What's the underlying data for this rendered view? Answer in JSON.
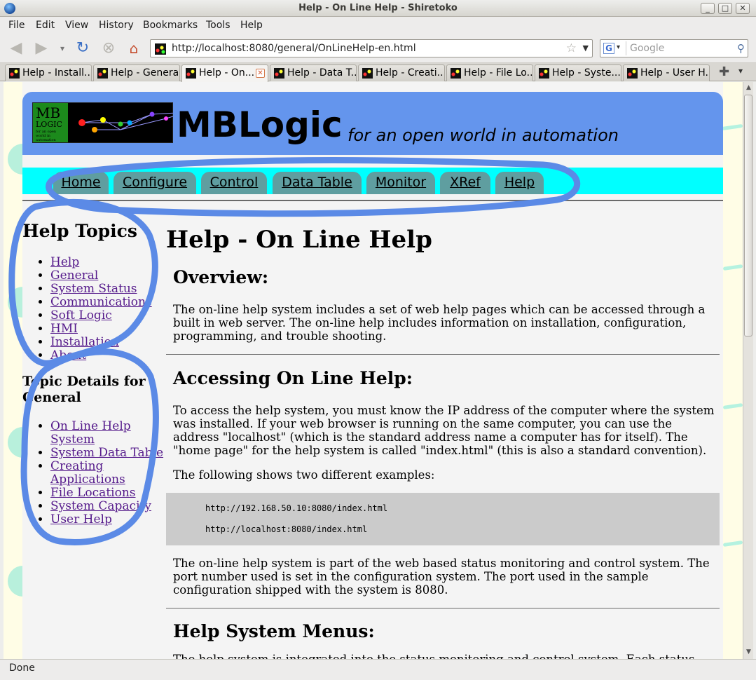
{
  "window": {
    "title": "Help - On Line Help - Shiretoko"
  },
  "menubar": {
    "items": [
      "File",
      "Edit",
      "View",
      "History",
      "Bookmarks",
      "Tools",
      "Help"
    ]
  },
  "toolbar": {
    "url": "http://localhost:8080/general/OnLineHelp-en.html",
    "search_engine": "G",
    "search_placeholder": "Google"
  },
  "tabs": [
    {
      "label": "Help - Install..."
    },
    {
      "label": "Help - General"
    },
    {
      "label": "Help - On...",
      "active": true
    },
    {
      "label": "Help - Data T..."
    },
    {
      "label": "Help - Creati..."
    },
    {
      "label": "Help - File Lo..."
    },
    {
      "label": "Help - Syste..."
    },
    {
      "label": "Help - User H..."
    }
  ],
  "page": {
    "logo": {
      "line1": "MB",
      "line2": "LOGIC",
      "small": "for an open world in automation"
    },
    "brand": "MBLogic",
    "tagline": "for an open world in automation",
    "nav": [
      "Home",
      "Configure",
      "Control",
      "Data Table",
      "Monitor",
      "XRef",
      "Help"
    ],
    "sidebar": {
      "topics_title": "Help Topics",
      "topics": [
        "Help",
        "General",
        "System Status",
        "Communications",
        "Soft Logic",
        "HMI",
        "Installation",
        "About"
      ],
      "details_title": "Topic Details for General",
      "details": [
        "On Line Help System",
        "System Data Table",
        "Creating Applications",
        "File Locations",
        "System Capacity",
        "User Help"
      ]
    },
    "main": {
      "title": "Help - On Line Help",
      "overview_heading": "Overview:",
      "overview_text": "The on-line help system includes a set of web help pages which can be accessed through a built in web server. The on-line help includes information on installation, configuration, programming, and trouble shooting.",
      "access_heading": "Accessing On Line Help:",
      "access_text": "To access the help system, you must know the IP address of the computer where the system was installed. If your web browser is running on the same computer, you can use the address \"localhost\" (which is the standard address name a computer has for itself). The \"home page\" for the help system is called \"index.html\" (this is also a standard convention).",
      "examples_text": "The following shows two different examples:",
      "code": [
        "http://192.168.50.10:8080/index.html",
        "http://localhost:8080/index.html"
      ],
      "port_text": "The on-line help system is part of the web based status monitoring and control system. The port number used is set in the configuration system. The port used in the sample configuration shipped with the system is 8080.",
      "menus_heading": "Help System Menus:",
      "menus_text": "The help system is integrated into the status monitoring and control system. Each status..."
    }
  },
  "statusbar": {
    "text": "Done"
  },
  "colors": {
    "banner": "#6495ed",
    "nav_row": "#00ffff",
    "nav_tab": "#5f9ea0",
    "annotation": "#5b8ae6"
  }
}
